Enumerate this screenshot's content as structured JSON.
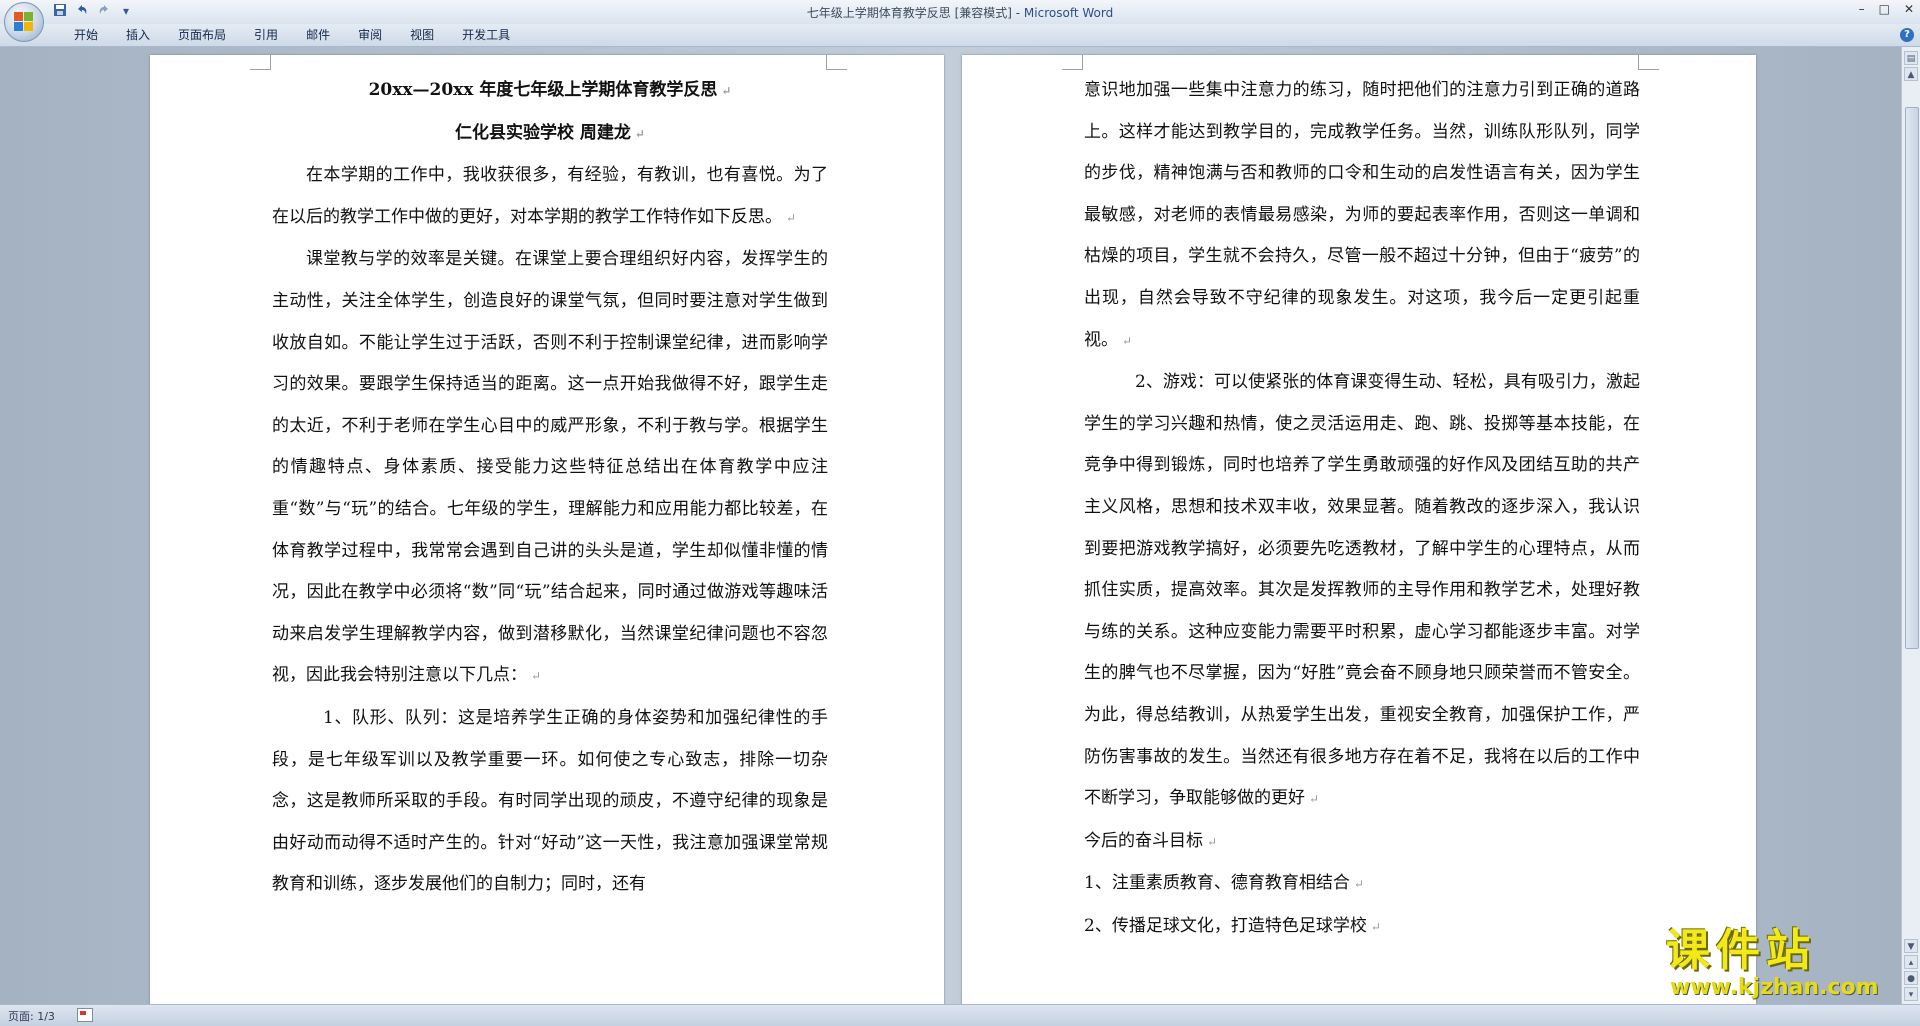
{
  "window": {
    "title": "七年级上学期体育教学反思 [兼容模式] - ",
    "app_name": "Microsoft Word",
    "controls": [
      "–",
      "□",
      "✕"
    ]
  },
  "quick_access": {
    "save": "save-icon",
    "undo": "undo-icon",
    "redo": "redo-icon",
    "customize": "▾"
  },
  "ribbon": {
    "tabs": [
      "开始",
      "插入",
      "页面布局",
      "引用",
      "邮件",
      "审阅",
      "视图",
      "开发工具"
    ],
    "help": "?"
  },
  "document": {
    "left_page": {
      "title": "20xx—20xx 年度七年级上学期体育教学反思",
      "subtitle": "仁化县实验学校   周建龙",
      "p1": "在本学期的工作中，我收获很多，有经验，有教训，也有喜悦。为了在以后的教学工作中做的更好，对本学期的教学工作特作如下反思。",
      "p2": "课堂教与学的效率是关键。在课堂上要合理组织好内容，发挥学生的主动性，关注全体学生，创造良好的课堂气氛，但同时要注意对学生做到收放自如。不能让学生过于活跃，否则不利于控制课堂纪律，进而影响学习的效果。要跟学生保持适当的距离。这一点开始我做得不好，跟学生走的太近，不利于老师在学生心目中的威严形象，不利于教与学。根据学生的情趣特点、身体素质、接受能力这些特征总结出在体育教学中应注重“数”与“玩”的结合。七年级的学生，理解能力和应用能力都比较差，在体育教学过程中，我常常会遇到自己讲的头头是道，学生却似懂非懂的情况，因此在教学中必须将“数”同“玩”结合起来，同时通过做游戏等趣味活动来启发学生理解教学内容，做到潜移默化，当然课堂纪律问题也不容忽视，因此我会特别注意以下几点：",
      "p3": "1、队形、队列：这是培养学生正确的身体姿势和加强纪律性的手段，是七年级军训以及教学重要一环。如何使之专心致志，排除一切杂念，这是教师所采取的手段。有时同学出现的顽皮，不遵守纪律的现象是由好动而动得不适时产生的。针对“好动”这一天性，我注意加强课堂常规教育和训练，逐步发展他们的自制力；同时，还有"
    },
    "right_page": {
      "p1": "意识地加强一些集中注意力的练习，随时把他们的注意力引到正确的道路上。这样才能达到教学目的，完成教学任务。当然，训练队形队列，同学的步伐，精神饱满与否和教师的口令和生动的启发性语言有关，因为学生最敏感，对老师的表情最易感染，为师的要起表率作用，否则这一单调和枯燥的项目，学生就不会持久，尽管一般不超过十分钟，但由于“疲劳”的出现，自然会导致不守纪律的现象发生。对这项，我今后一定更引起重视。",
      "p2": "2、游戏：可以使紧张的体育课变得生动、轻松，具有吸引力，激起学生的学习兴趣和热情，使之灵活运用走、跑、跳、投掷等基本技能，在竞争中得到锻炼，同时也培养了学生勇敢顽强的好作风及团结互助的共产主义风格，思想和技术双丰收，效果显著。随着教改的逐步深入，我认识到要把游戏教学搞好，必须要先吃透教材，了解中学生的心理特点，从而抓住实质，提高效率。其次是发挥教师的主导作用和教学艺术，处理好教与练的关系。这种应变能力需要平时积累，虚心学习都能逐步丰富。对学生的脾气也不尽掌握，因为“好胜”竟会奋不顾身地只顾荣誉而不管安全。为此，得总结教训，从热爱学生出发，重视安全教育，加强保护工作，严防伤害事故的发生。当然还有很多地方存在着不足，我将在以后的工作中不断学习，争取能够做的更好",
      "goal_heading": "今后的奋斗目标",
      "goal1": "1、注重素质教育、德育教育相结合",
      "goal2": "2、传播足球文化，打造特色足球学校"
    },
    "paragraph_mark": "↵"
  },
  "statusbar": {
    "page_indicator": "页面: 1/3"
  },
  "watermark": {
    "name": "课件站",
    "url": "www.kjzhan.com"
  },
  "colors": {
    "app_title": "#2a4e8d",
    "watermark": "#f3e81a"
  }
}
